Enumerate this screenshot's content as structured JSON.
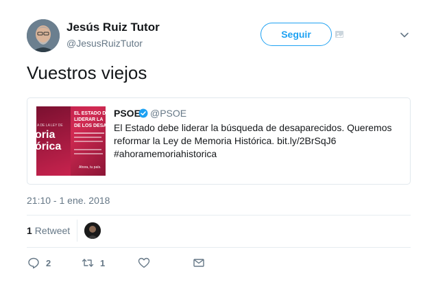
{
  "author": {
    "name": "Jesús Ruiz Tutor",
    "handle": "@JesusRuizTutor"
  },
  "follow_button_label": "Seguir",
  "tweet_text": "Vuestros viejos",
  "quoted_tweet": {
    "author_name": "PSOE",
    "author_handle": "@PSOE",
    "text": "El Estado debe liderar la búsqueda de desaparecidos. Queremos reformar la Ley de Memoria Histórica. bit.ly/2BrSqJ6 #ahoramemoriahistorica",
    "thumbnail": {
      "line1": "EL ESTADO D",
      "line2": "LIDERAR LA",
      "line3": "DE LOS DESA",
      "left_top": "A DE LA LEY DE",
      "left_big1": "oria",
      "left_big2": "órica",
      "footer": "Ahora, tu país."
    }
  },
  "timestamp": "21:10 - 1 ene. 2018",
  "stats": {
    "retweet_count": "1",
    "retweet_label": "Retweet"
  },
  "actions": {
    "reply_count": "2",
    "retweet_count": "1"
  },
  "colors": {
    "accent": "#1da1f2",
    "muted": "#657786",
    "thumbnail_red": "#c8234e"
  }
}
